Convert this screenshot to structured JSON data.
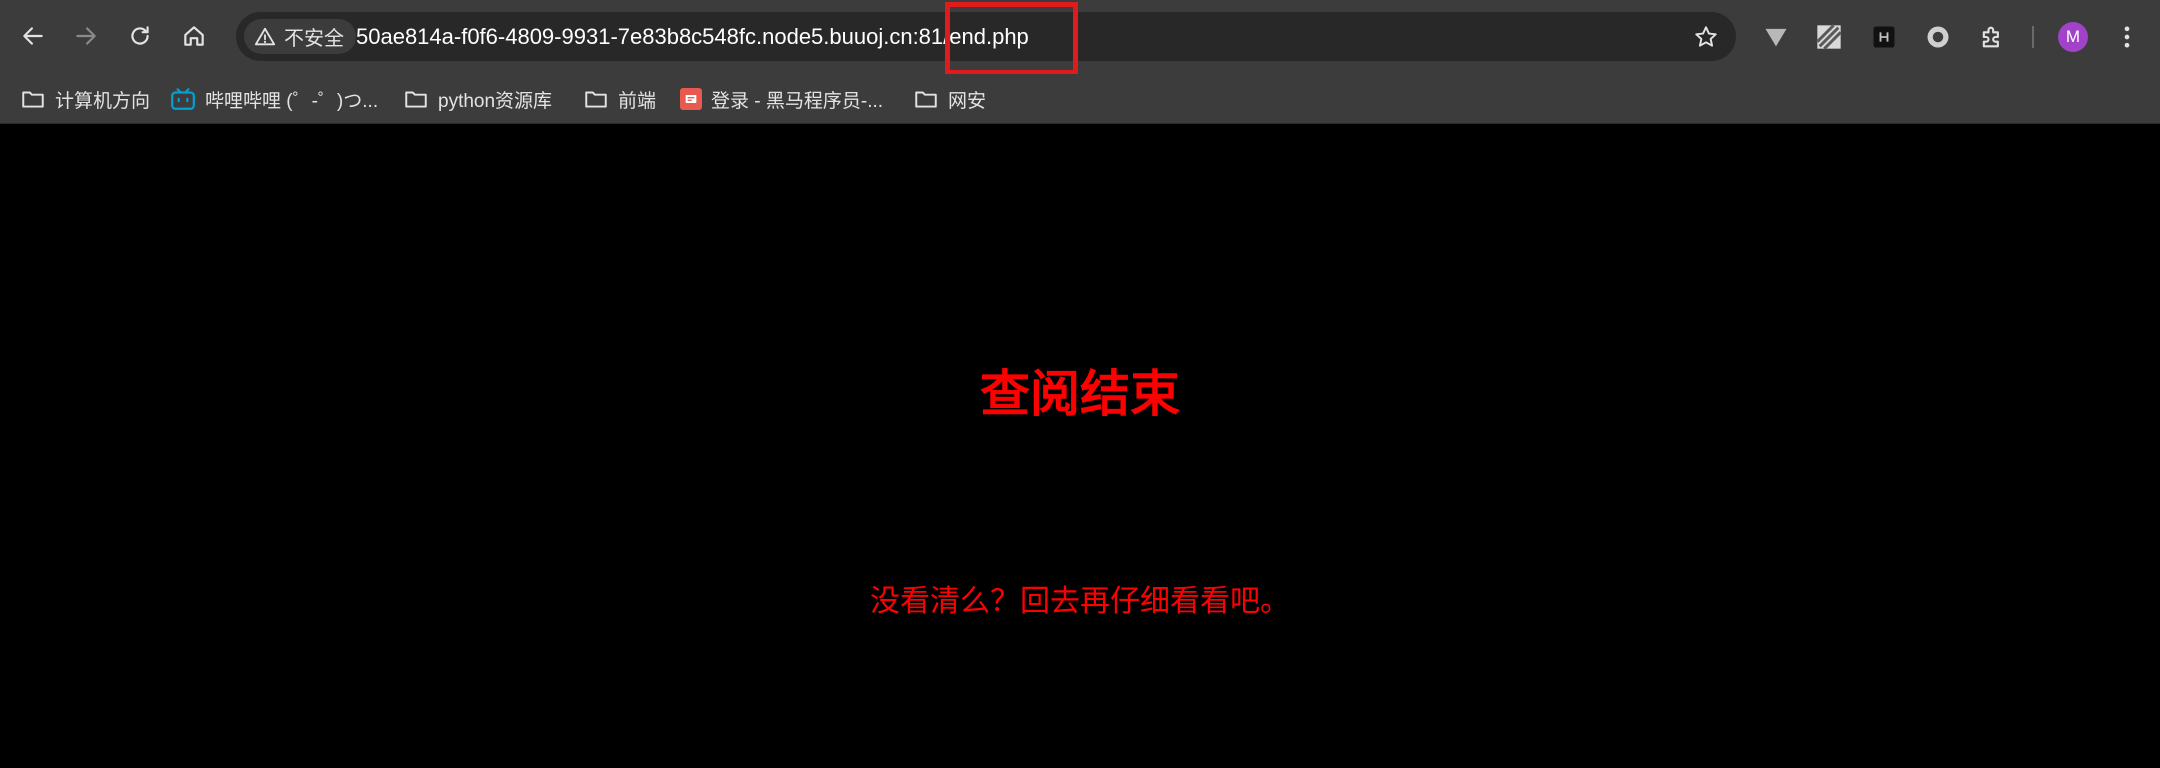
{
  "browser": {
    "security_label": "不安全",
    "url": "50ae814a-f0f6-4809-9931-7e83b8c548fc.node5.buuoj.cn:81/end.php",
    "highlight_color": "#e01b1b",
    "extensions": [
      "vimium-icon",
      "ext-stripe-icon",
      "ext-dark-h-icon",
      "ext-ring-icon",
      "puzzle-icon"
    ],
    "profile_initial": "M",
    "profile_color": "#a142c9"
  },
  "bookmarks": [
    {
      "label": "计算机方向",
      "icon": "folder-icon"
    },
    {
      "label": "哔哩哔哩 (゜-゜)つ...",
      "icon": "bilibili-icon"
    },
    {
      "label": "python资源库",
      "icon": "folder-icon"
    },
    {
      "label": "前端",
      "icon": "folder-icon"
    },
    {
      "label": "登录 - 黑马程序员-...",
      "icon": "heima-icon"
    },
    {
      "label": "网安",
      "icon": "folder-icon"
    }
  ],
  "page": {
    "heading": "查阅结束",
    "message": "没看清么？回去再仔细看看吧。",
    "text_color": "#ff0000",
    "background": "#000000"
  }
}
